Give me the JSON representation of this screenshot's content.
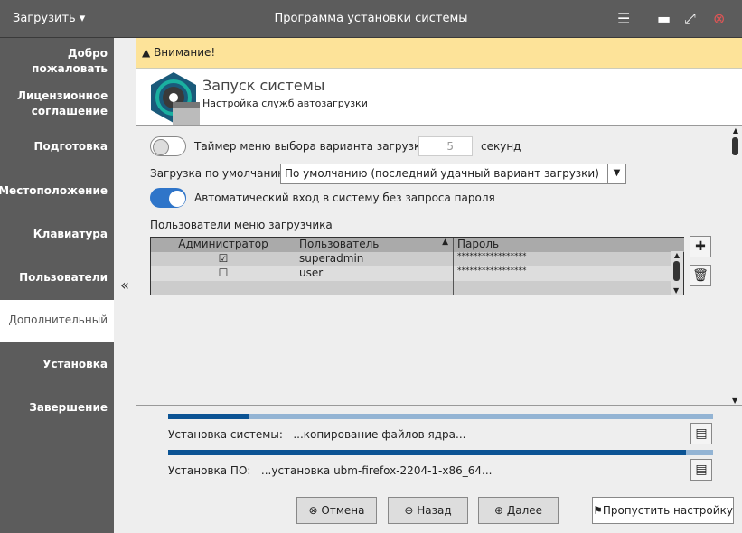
{
  "window": {
    "menu_label": "Загрузить",
    "title": "Программа установки системы"
  },
  "sidebar": {
    "items": [
      {
        "label": "Добро пожаловать"
      },
      {
        "label": "Лицензионное соглашение"
      },
      {
        "label": "Подготовка"
      },
      {
        "label": "Местоположение"
      },
      {
        "label": "Клавиатура"
      },
      {
        "label": "Пользователи"
      },
      {
        "label": "Дополнительный"
      },
      {
        "label": "Установка"
      },
      {
        "label": "Завершение"
      }
    ],
    "active": "Дополнительный",
    "collapse_glyph": "«"
  },
  "warning": {
    "text": "Внимание!"
  },
  "header": {
    "title": "Запуск системы",
    "subtitle": "Настройка служб автозагрузки"
  },
  "settings": {
    "timer_label": "Таймер меню выбора варианта загрузки:",
    "timer_enabled": false,
    "timer_value": "5",
    "timer_unit": "секунд",
    "default_label": "Загрузка по умолчанию:",
    "default_value": "По умолчанию (последний удачный вариант загрузки)",
    "autologin_label": "Автоматический вход в систему без запроса пароля",
    "autologin_enabled": true,
    "users_label": "Пользователи меню загрузчика"
  },
  "users_table": {
    "columns": [
      "Администратор",
      "Пользователь",
      "Пароль"
    ],
    "rows": [
      {
        "admin": true,
        "admin_glyph": "☑",
        "user": "superadmin",
        "password": "*****************"
      },
      {
        "admin": false,
        "admin_glyph": "☐",
        "user": "user",
        "password": "*****************"
      }
    ]
  },
  "progress": {
    "system": {
      "label": "Установка системы:",
      "status": "...копирование файлов ядра...",
      "percent": 15
    },
    "software": {
      "label": "Установка ПО:",
      "status": "...установка ubm-firefox-2204-1-x86_64...",
      "percent": 95
    }
  },
  "buttons": {
    "cancel": "Отмена",
    "back": "Назад",
    "next": "Далее",
    "skip": "Пропустить настройку"
  }
}
